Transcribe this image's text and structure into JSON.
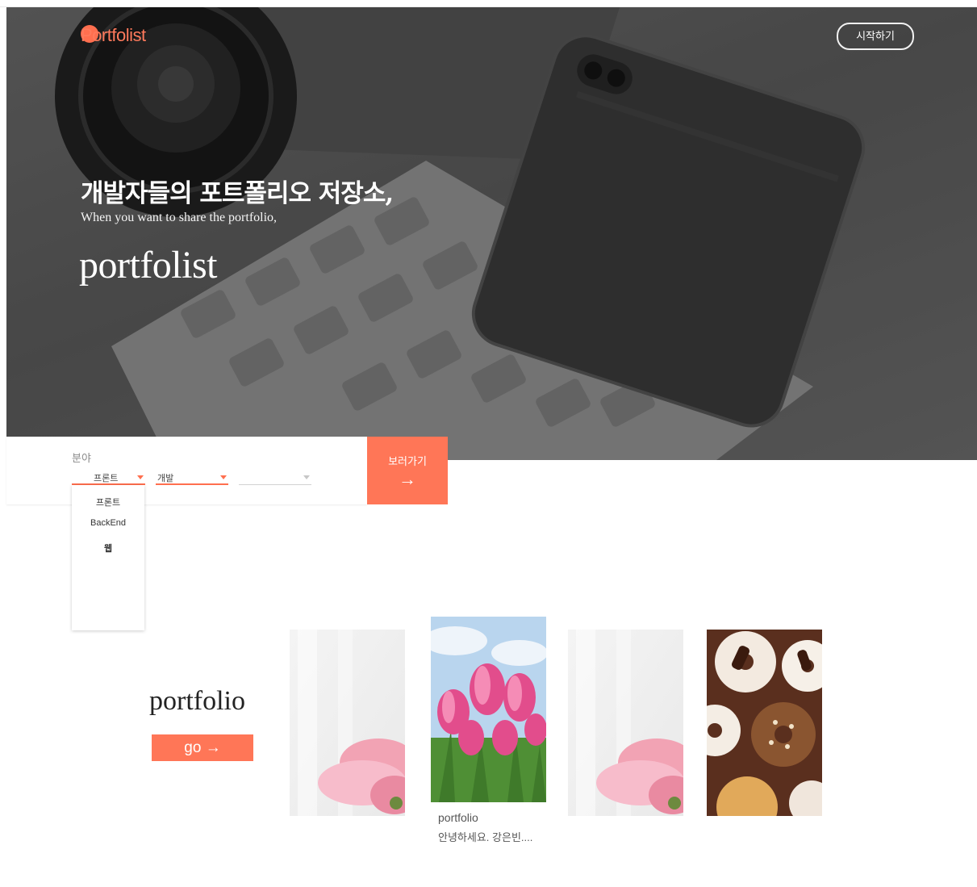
{
  "header": {
    "logo": "Portfolist",
    "start_button": "시작하기"
  },
  "hero": {
    "title_kr": "개발자들의 포트폴리오 저장소,",
    "subtitle_en": "When you want to share the portfolio,",
    "brand": "portfolist",
    "device_label": "iPhone"
  },
  "filter": {
    "label": "분야",
    "select1_value": "프론트",
    "select2_value": "개발",
    "select3_value": "",
    "submit_label": "보러가기",
    "submit_arrow": "→",
    "dropdown_options": [
      "프론트",
      "BackEnd",
      "웹"
    ]
  },
  "portfolio": {
    "title": "portfolio",
    "go_label": "go →",
    "featured_caption_title": "portfolio",
    "featured_caption_text": "안녕하세요. 강은빈...."
  },
  "colors": {
    "accent": "#ff7657",
    "hero_overlay": "#666666"
  },
  "icons": {
    "submit": "arrow-right-icon",
    "caret": "caret-down-icon"
  }
}
